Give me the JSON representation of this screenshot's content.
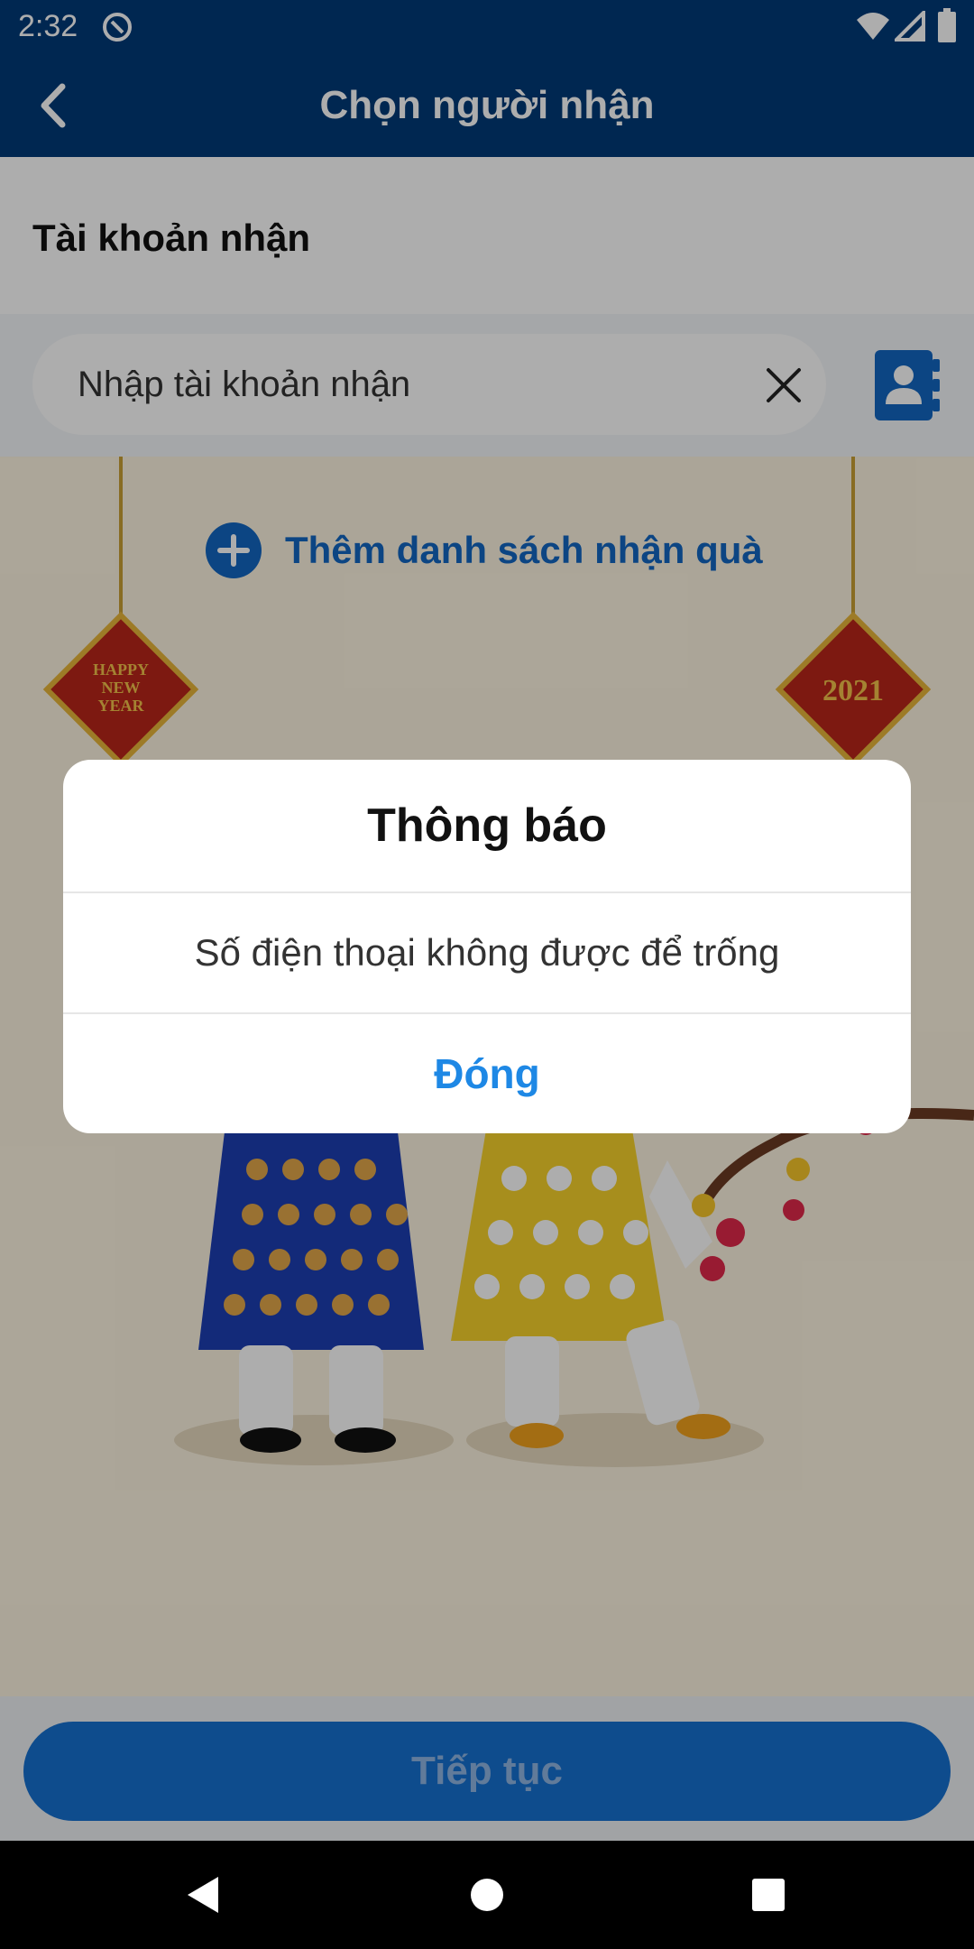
{
  "status_bar": {
    "time": "2:32"
  },
  "app_bar": {
    "title": "Chọn người nhận"
  },
  "account": {
    "label": "Tài khoản nhận",
    "input_placeholder": "Nhập tài khoản nhận",
    "input_value": ""
  },
  "add_list": {
    "label": "Thêm danh sách nhận quà"
  },
  "festive": {
    "left_sign": "HAPPY NEW YEAR",
    "right_sign": "2021"
  },
  "continue_button": {
    "label": "Tiếp tục"
  },
  "dialog": {
    "title": "Thông báo",
    "message": "Số điện thoại không được để trống",
    "close_label": "Đóng"
  },
  "colors": {
    "primary": "#003a78",
    "accent": "#1670d0",
    "link": "#1e88e5"
  }
}
